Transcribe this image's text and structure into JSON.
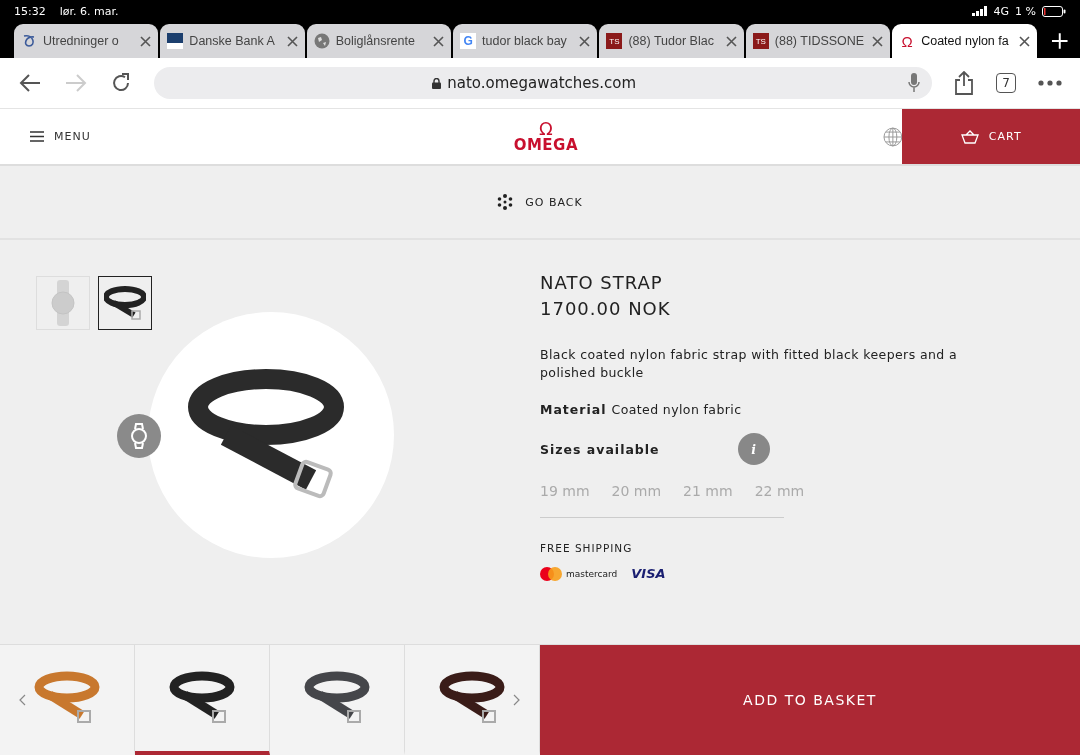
{
  "status_bar": {
    "time": "15:32",
    "date": "lør. 6. mar.",
    "network": "4G",
    "battery": "1 %"
  },
  "browser_tabs": [
    {
      "title": "Utredninger o",
      "kind": "knot",
      "selected": false
    },
    {
      "title": "Danske Bank A",
      "kind": "flag",
      "selected": false
    },
    {
      "title": "Boliglånsrente",
      "kind": "globe",
      "selected": false
    },
    {
      "title": "tudor black bay",
      "kind": "letter",
      "glyph": "G",
      "selected": false
    },
    {
      "title": "(88) Tudor Blac",
      "kind": "badge",
      "glyph": "TS",
      "selected": false
    },
    {
      "title": "(88) TIDSSONE",
      "kind": "badge",
      "glyph": "TS",
      "selected": false
    },
    {
      "title": "Coated nylon fa",
      "kind": "omega",
      "glyph": "Ω",
      "selected": true
    }
  ],
  "toolbar": {
    "url": "nato.omegawatches.com",
    "tab_count": "7"
  },
  "header": {
    "menu": "MENU",
    "logo_mark": "Ω",
    "logo": "OMEGA",
    "cart": "CART"
  },
  "go_back": "GO BACK",
  "gallery": [
    {
      "kind": "watch",
      "selected": false
    },
    {
      "kind": "strap",
      "selected": true
    }
  ],
  "product": {
    "name": "NATO STRAP",
    "price": "1700.00 NOK",
    "description": "Black coated nylon fabric strap with fitted black keepers and a polished buckle",
    "material_label": "Material",
    "material": "Coated nylon fabric",
    "sizes_label": "Sizes available",
    "info": "i",
    "sizes": [
      {
        "label": "19 mm",
        "selected": false
      },
      {
        "label": "20 mm",
        "selected": false
      },
      {
        "label": "21 mm",
        "selected": false
      },
      {
        "label": "22 mm",
        "selected": false
      }
    ],
    "shipping": "FREE SHIPPING",
    "payments": [
      "mastercard",
      "VISA"
    ]
  },
  "variants": [
    {
      "color": "#c8782e",
      "selected": false
    },
    {
      "color": "#222222",
      "selected": true
    },
    {
      "color": "#45464a",
      "selected": false
    },
    {
      "color": "#3a1c18",
      "selected": false
    }
  ],
  "add_to_basket": "ADD TO BASKET"
}
